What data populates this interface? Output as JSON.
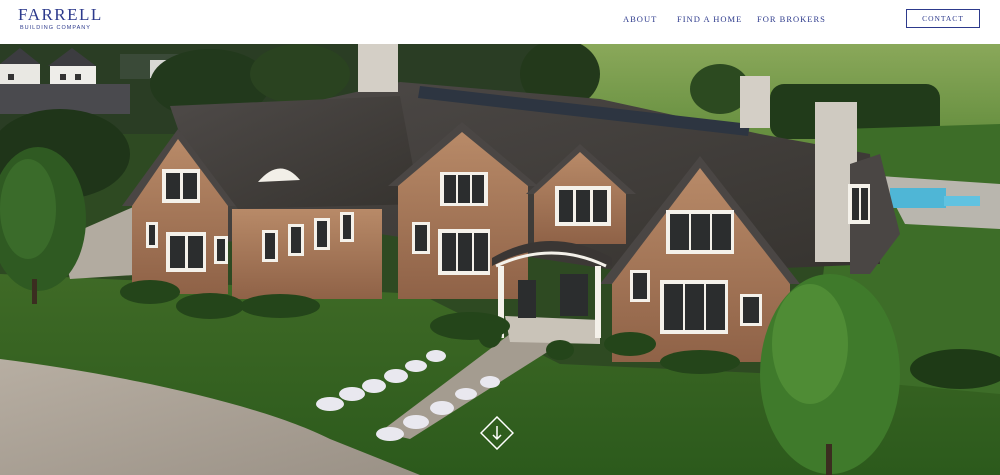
{
  "brand": {
    "name": "FARRELL",
    "tagline": "BUILDING COMPANY",
    "color": "#2d3a8c"
  },
  "nav": {
    "items": [
      {
        "label": "ABOUT"
      },
      {
        "label": "FIND A HOME"
      },
      {
        "label": "FOR BROKERS"
      }
    ],
    "contact_label": "CONTACT"
  },
  "hero": {
    "image": "aerial-house-photo",
    "scroll_icon": "arrow-down-icon"
  }
}
